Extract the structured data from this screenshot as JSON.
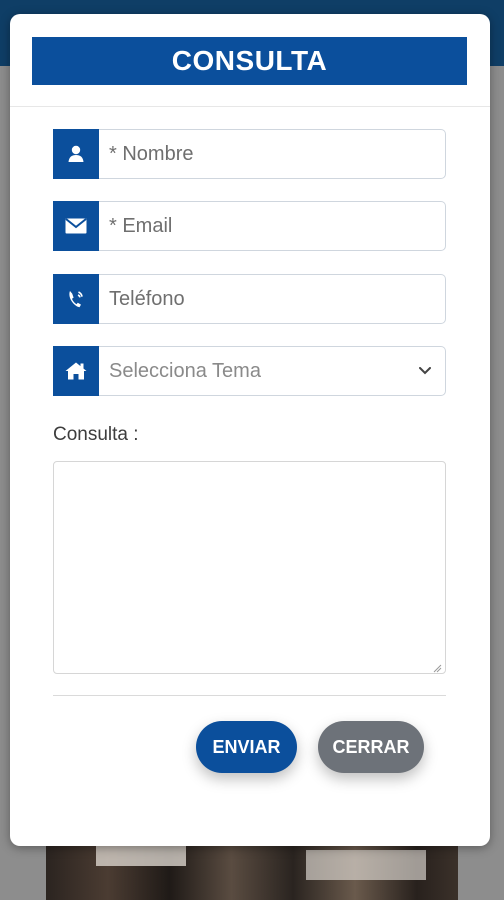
{
  "modal": {
    "title": "CONSULTA"
  },
  "form": {
    "name_placeholder": "* Nombre",
    "email_placeholder": "* Email",
    "phone_placeholder": "Teléfono",
    "topic_select_value": "Selecciona Tema",
    "message_label": "Consulta :"
  },
  "buttons": {
    "submit_label": "ENVIAR",
    "close_label": "CERRAR"
  },
  "colors": {
    "brand_blue": "#0b4f9c",
    "close_gray": "#6d7279",
    "header_navy": "#0f3e66"
  },
  "icons": {
    "name": "user-icon",
    "email": "envelope-icon",
    "phone": "phone-icon",
    "topic": "home-icon",
    "select": "chevron-down-icon"
  }
}
